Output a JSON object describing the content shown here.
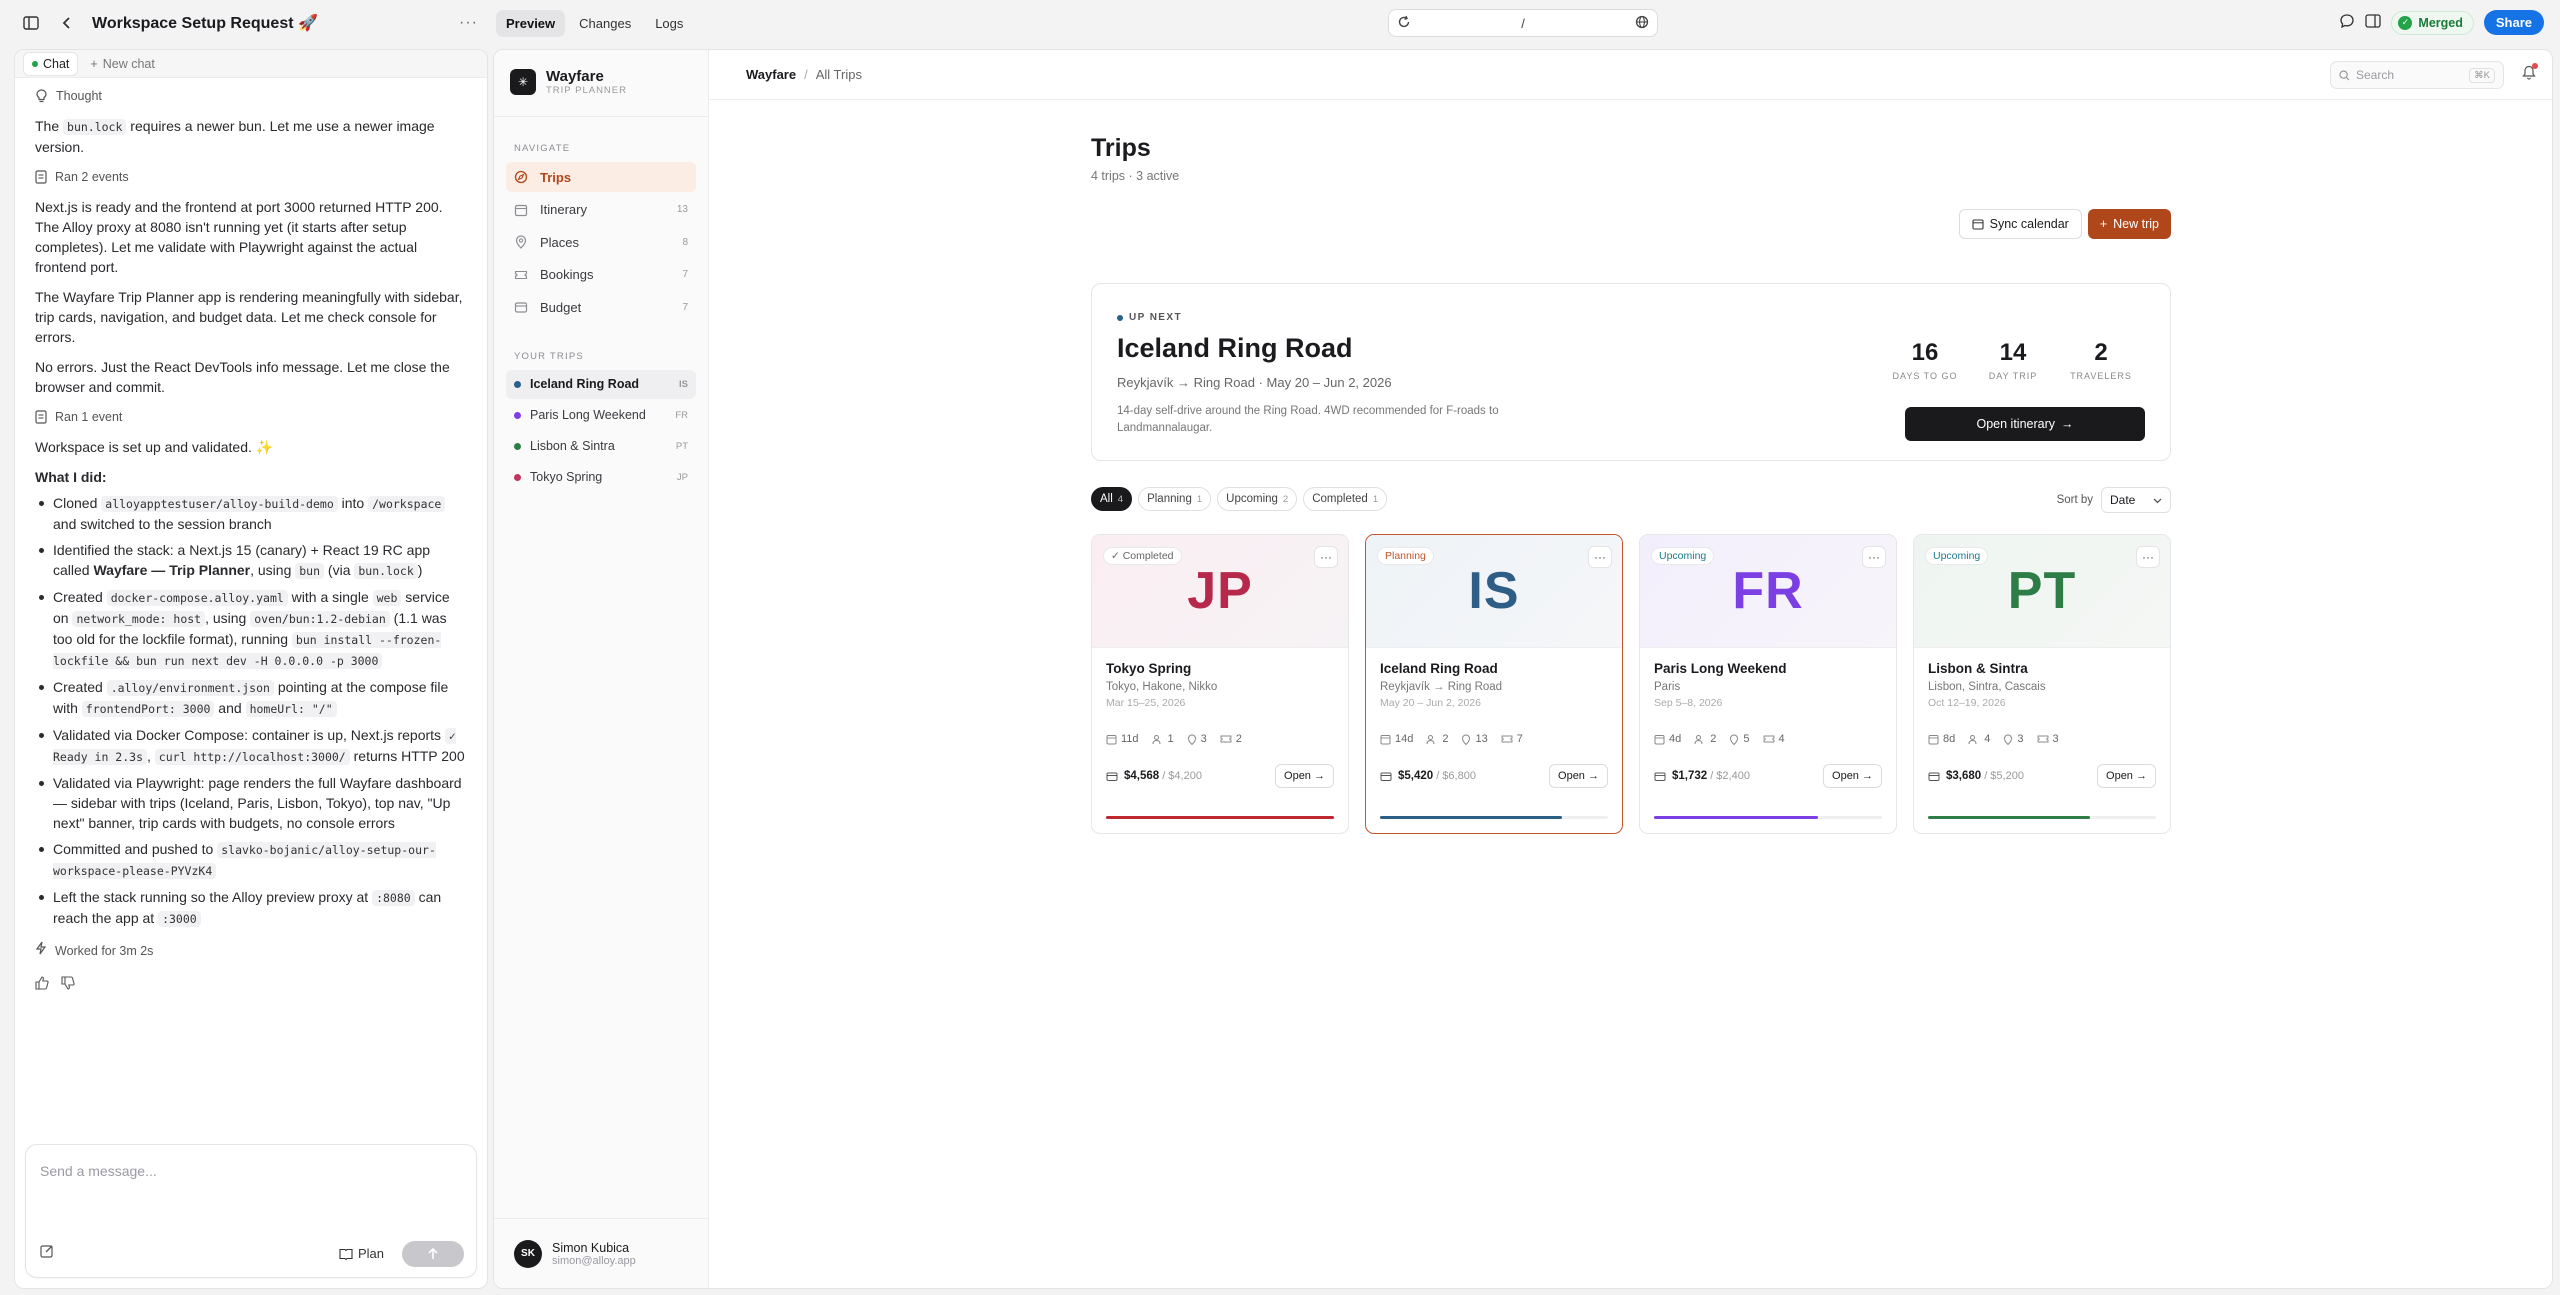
{
  "topbar": {
    "title": "Workspace Setup Request 🚀",
    "tabs": [
      "Preview",
      "Changes",
      "Logs"
    ],
    "url": "/",
    "merged_label": "Merged",
    "share_label": "Share"
  },
  "chat": {
    "tabs": {
      "active": "Chat",
      "new": "New chat"
    },
    "thought_label": "Thought",
    "ran2": "Ran 2 events",
    "ran1": "Ran 1 event",
    "para1a": "The ",
    "para1code": "bun.lock",
    "para1b": " requires a newer bun. Let me use a newer image version.",
    "para2": "Next.js is ready and the frontend at port 3000 returned HTTP 200. The Alloy proxy at 8080 isn't running yet (it starts after setup completes). Let me validate with Playwright against the actual frontend port.",
    "para3": "The Wayfare Trip Planner app is rendering meaningfully with sidebar, trip cards, navigation, and budget data. Let me check console for errors.",
    "para4": "No errors. Just the React DevTools info message. Let me close the browser and commit.",
    "para5": "Workspace is set up and validated. ✨",
    "what_i_did": "What I did:",
    "worked": "Worked for 3m 2s",
    "composer_placeholder": "Send a message...",
    "plan_label": "Plan"
  },
  "app": {
    "brand": {
      "name": "Wayfare",
      "sub": "TRIP PLANNER"
    },
    "nav_label": "NAVIGATE",
    "nav": [
      {
        "label": "Trips",
        "count": ""
      },
      {
        "label": "Itinerary",
        "count": "13"
      },
      {
        "label": "Places",
        "count": "8"
      },
      {
        "label": "Bookings",
        "count": "7"
      },
      {
        "label": "Budget",
        "count": "7"
      }
    ],
    "trips_label": "YOUR TRIPS",
    "trips": [
      {
        "name": "Iceland Ring Road",
        "code": "IS",
        "color": "#2b5f86"
      },
      {
        "name": "Paris Long Weekend",
        "code": "FR",
        "color": "#7b3fe4"
      },
      {
        "name": "Lisbon & Sintra",
        "code": "PT",
        "color": "#2f7d46"
      },
      {
        "name": "Tokyo Spring",
        "code": "JP",
        "color": "#c2335d"
      }
    ],
    "user": {
      "initials": "SK",
      "name": "Simon Kubica",
      "email": "simon@alloy.app"
    },
    "breadcrumb": {
      "root": "Wayfare",
      "current": "All Trips"
    },
    "search": {
      "placeholder": "Search",
      "kbd": "⌘K"
    },
    "page": {
      "title": "Trips",
      "subtitle": "4 trips · 3 active",
      "sync": "Sync calendar",
      "new_trip": "New trip"
    },
    "upnext": {
      "tag": "UP NEXT",
      "title": "Iceland Ring Road",
      "route": "Reykjavík → Ring Road · May 20 – Jun 2, 2026",
      "desc": "14-day self-drive around the Ring Road. 4WD recommended for F-roads to Landmannalaugar.",
      "stats": [
        {
          "num": "16",
          "label": "DAYS TO GO"
        },
        {
          "num": "14",
          "label": "DAY TRIP"
        },
        {
          "num": "2",
          "label": "TRAVELERS"
        }
      ],
      "cta": "Open itinerary"
    },
    "filters": [
      {
        "label": "All",
        "count": "4"
      },
      {
        "label": "Planning",
        "count": "1"
      },
      {
        "label": "Upcoming",
        "count": "2"
      },
      {
        "label": "Completed",
        "count": "1"
      }
    ],
    "sort": {
      "label": "Sort by",
      "value": "Date"
    },
    "cards": [
      {
        "code": "JP",
        "status": "✓ Completed",
        "status_color": "#666",
        "title": "Tokyo Spring",
        "places": "Tokyo, Hakone, Nikko",
        "dates": "Mar 15–25, 2026",
        "days": "11d",
        "travelers": "1",
        "places_count": "3",
        "bookings": "2",
        "spent": "$4,568",
        "budget": "/ $4,200",
        "progress": 1.0,
        "accent": "#b6294a",
        "bar": "#c0282f",
        "bg": "linear-gradient(135deg,#fbeef2,#f6f3f5)"
      },
      {
        "code": "IS",
        "status": "Planning",
        "status_color": "#c2542a",
        "title": "Iceland Ring Road",
        "places": "Reykjavík → Ring Road",
        "dates": "May 20 – Jun 2, 2026",
        "days": "14d",
        "travelers": "2",
        "places_count": "13",
        "bookings": "7",
        "spent": "$5,420",
        "budget": "/ $6,800",
        "progress": 0.8,
        "accent": "#2e5e86",
        "bar": "#2b5f86",
        "bg": "linear-gradient(135deg,#eef3f7,#f5f6f8)"
      },
      {
        "code": "FR",
        "status": "Upcoming",
        "status_color": "#1f7a8c",
        "title": "Paris Long Weekend",
        "places": "Paris",
        "dates": "Sep 5–8, 2026",
        "days": "4d",
        "travelers": "2",
        "places_count": "5",
        "bookings": "4",
        "spent": "$1,732",
        "budget": "/ $2,400",
        "progress": 0.72,
        "accent": "#7b3fe4",
        "bar": "#7b3fe4",
        "bg": "linear-gradient(135deg,#f3eefc,#f7f5fa)"
      },
      {
        "code": "PT",
        "status": "Upcoming",
        "status_color": "#1f7a8c",
        "title": "Lisbon & Sintra",
        "places": "Lisbon, Sintra, Cascais",
        "dates": "Oct 12–19, 2026",
        "days": "8d",
        "travelers": "4",
        "places_count": "3",
        "bookings": "3",
        "spent": "$3,680",
        "budget": "/ $5,200",
        "progress": 0.71,
        "accent": "#2f7d46",
        "bar": "#2f7d46",
        "bg": "linear-gradient(135deg,#eef5f0,#f5f7f5)"
      }
    ],
    "card_open": "Open"
  }
}
